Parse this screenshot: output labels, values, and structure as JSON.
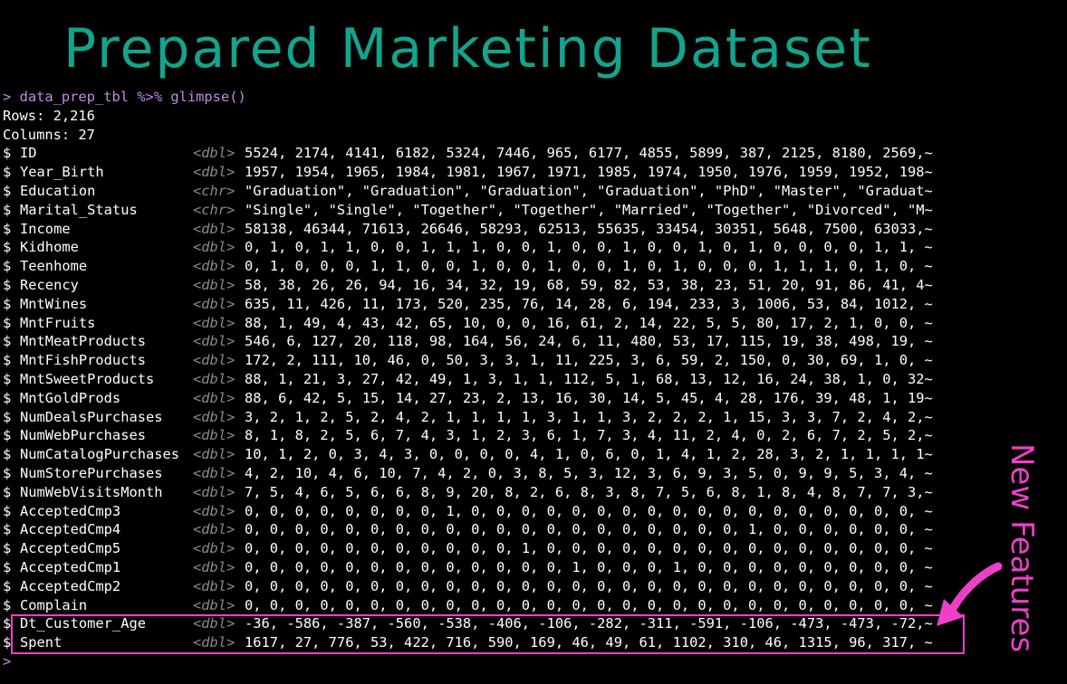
{
  "title": "Prepared Marketing Dataset",
  "console": {
    "prompt": ">",
    "command": "data_prep_tbl %>% glimpse()",
    "rows_line": "Rows: 2,216",
    "columns_line": "Columns: 27",
    "cursor_prompt": ">",
    "variables": [
      {
        "name": "ID",
        "type": "<dbl>",
        "values": "5524, 2174, 4141, 6182, 5324, 7446, 965, 6177, 4855, 5899, 387, 2125, 8180, 2569,~"
      },
      {
        "name": "Year_Birth",
        "type": "<dbl>",
        "values": "1957, 1954, 1965, 1984, 1981, 1967, 1971, 1985, 1974, 1950, 1976, 1959, 1952, 198~"
      },
      {
        "name": "Education",
        "type": "<chr>",
        "values": "\"Graduation\", \"Graduation\", \"Graduation\", \"Graduation\", \"PhD\", \"Master\", \"Graduat~"
      },
      {
        "name": "Marital_Status",
        "type": "<chr>",
        "values": "\"Single\", \"Single\", \"Together\", \"Together\", \"Married\", \"Together\", \"Divorced\", \"M~"
      },
      {
        "name": "Income",
        "type": "<dbl>",
        "values": "58138, 46344, 71613, 26646, 58293, 62513, 55635, 33454, 30351, 5648, 7500, 63033,~"
      },
      {
        "name": "Kidhome",
        "type": "<dbl>",
        "values": "0, 1, 0, 1, 1, 0, 0, 1, 1, 1, 0, 0, 1, 0, 0, 1, 0, 0, 1, 0, 1, 0, 0, 0, 0, 1, 1, ~"
      },
      {
        "name": "Teenhome",
        "type": "<dbl>",
        "values": "0, 1, 0, 0, 0, 1, 1, 0, 0, 1, 0, 0, 1, 0, 0, 1, 0, 1, 0, 0, 0, 1, 1, 1, 0, 1, 0, ~"
      },
      {
        "name": "Recency",
        "type": "<dbl>",
        "values": "58, 38, 26, 26, 94, 16, 34, 32, 19, 68, 59, 82, 53, 38, 23, 51, 20, 91, 86, 41, 4~"
      },
      {
        "name": "MntWines",
        "type": "<dbl>",
        "values": "635, 11, 426, 11, 173, 520, 235, 76, 14, 28, 6, 194, 233, 3, 1006, 53, 84, 1012, ~"
      },
      {
        "name": "MntFruits",
        "type": "<dbl>",
        "values": "88, 1, 49, 4, 43, 42, 65, 10, 0, 0, 16, 61, 2, 14, 22, 5, 5, 80, 17, 2, 1, 0, 0, ~"
      },
      {
        "name": "MntMeatProducts",
        "type": "<dbl>",
        "values": "546, 6, 127, 20, 118, 98, 164, 56, 24, 6, 11, 480, 53, 17, 115, 19, 38, 498, 19, ~"
      },
      {
        "name": "MntFishProducts",
        "type": "<dbl>",
        "values": "172, 2, 111, 10, 46, 0, 50, 3, 3, 1, 11, 225, 3, 6, 59, 2, 150, 0, 30, 69, 1, 0, ~"
      },
      {
        "name": "MntSweetProducts",
        "type": "<dbl>",
        "values": "88, 1, 21, 3, 27, 42, 49, 1, 3, 1, 1, 112, 5, 1, 68, 13, 12, 16, 24, 38, 1, 0, 32~"
      },
      {
        "name": "MntGoldProds",
        "type": "<dbl>",
        "values": "88, 6, 42, 5, 15, 14, 27, 23, 2, 13, 16, 30, 14, 5, 45, 4, 28, 176, 39, 48, 1, 19~"
      },
      {
        "name": "NumDealsPurchases",
        "type": "<dbl>",
        "values": "3, 2, 1, 2, 5, 2, 4, 2, 1, 1, 1, 1, 3, 1, 1, 3, 2, 2, 2, 1, 15, 3, 3, 7, 2, 4, 2,~"
      },
      {
        "name": "NumWebPurchases",
        "type": "<dbl>",
        "values": "8, 1, 8, 2, 5, 6, 7, 4, 3, 1, 2, 3, 6, 1, 7, 3, 4, 11, 2, 4, 0, 2, 6, 7, 2, 5, 2,~"
      },
      {
        "name": "NumCatalogPurchases",
        "type": "<dbl>",
        "values": "10, 1, 2, 0, 3, 4, 3, 0, 0, 0, 0, 4, 1, 0, 6, 0, 1, 4, 1, 2, 28, 3, 2, 1, 1, 1, 1~"
      },
      {
        "name": "NumStorePurchases",
        "type": "<dbl>",
        "values": "4, 2, 10, 4, 6, 10, 7, 4, 2, 0, 3, 8, 5, 3, 12, 3, 6, 9, 3, 5, 0, 9, 9, 5, 3, 4, ~"
      },
      {
        "name": "NumWebVisitsMonth",
        "type": "<dbl>",
        "values": "7, 5, 4, 6, 5, 6, 6, 8, 9, 20, 8, 2, 6, 8, 3, 8, 7, 5, 6, 8, 1, 8, 4, 8, 7, 7, 3,~"
      },
      {
        "name": "AcceptedCmp3",
        "type": "<dbl>",
        "values": "0, 0, 0, 0, 0, 0, 0, 0, 1, 0, 0, 0, 0, 0, 0, 0, 0, 0, 0, 0, 0, 0, 0, 0, 0, 0, 0, ~"
      },
      {
        "name": "AcceptedCmp4",
        "type": "<dbl>",
        "values": "0, 0, 0, 0, 0, 0, 0, 0, 0, 0, 0, 0, 0, 0, 0, 0, 0, 0, 0, 0, 1, 0, 0, 0, 0, 0, 0, ~"
      },
      {
        "name": "AcceptedCmp5",
        "type": "<dbl>",
        "values": "0, 0, 0, 0, 0, 0, 0, 0, 0, 0, 0, 1, 0, 0, 0, 0, 0, 0, 0, 0, 0, 0, 0, 0, 0, 0, 0, ~"
      },
      {
        "name": "AcceptedCmp1",
        "type": "<dbl>",
        "values": "0, 0, 0, 0, 0, 0, 0, 0, 0, 0, 0, 0, 0, 1, 0, 0, 0, 1, 0, 0, 0, 0, 0, 0, 0, 0, 0, ~"
      },
      {
        "name": "AcceptedCmp2",
        "type": "<dbl>",
        "values": "0, 0, 0, 0, 0, 0, 0, 0, 0, 0, 0, 0, 0, 0, 0, 0, 0, 0, 0, 0, 0, 0, 0, 0, 0, 0, 0, ~"
      },
      {
        "name": "Complain",
        "type": "<dbl>",
        "values": "0, 0, 0, 0, 0, 0, 0, 0, 0, 0, 0, 0, 0, 0, 0, 0, 0, 0, 0, 0, 0, 0, 0, 0, 0, 0, 0, ~"
      },
      {
        "name": "Dt_Customer_Age",
        "type": "<dbl>",
        "values": "-36, -586, -387, -560, -538, -406, -106, -282, -311, -591, -106, -473, -473, -72,~"
      },
      {
        "name": "Spent",
        "type": "<dbl>",
        "values": "1617, 27, 776, 53, 422, 716, 590, 169, 46, 49, 61, 1102, 310, 46, 1315, 96, 317, ~"
      }
    ]
  },
  "annotation": {
    "label": "New Features",
    "color": "#ee3fc8"
  },
  "colors": {
    "title": "#13a48e",
    "command": "#c08ae6",
    "type_tag": "#8a8a8a",
    "highlight": "#ee3fc8"
  }
}
